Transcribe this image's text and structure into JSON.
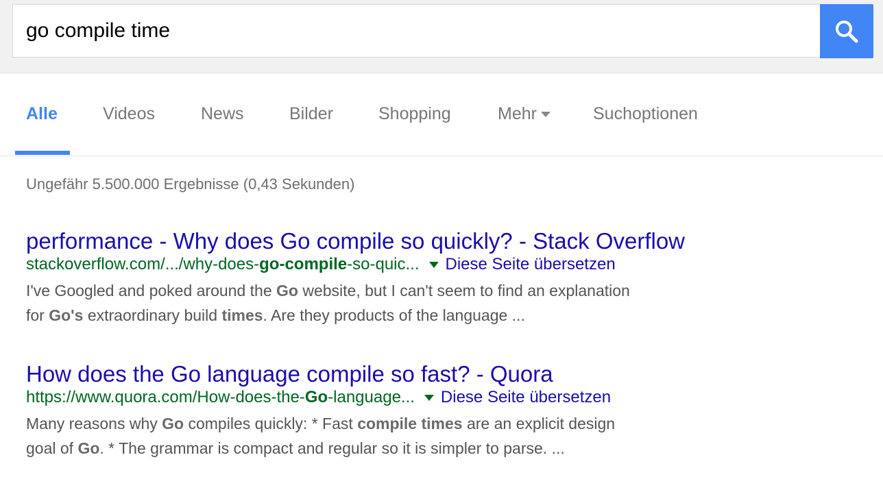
{
  "search": {
    "query": "go compile time",
    "button_icon": "search-icon",
    "button_color": "#4285f4"
  },
  "tabs": {
    "items": [
      {
        "label": "Alle",
        "active": true
      },
      {
        "label": "Videos",
        "active": false
      },
      {
        "label": "News",
        "active": false
      },
      {
        "label": "Bilder",
        "active": false
      },
      {
        "label": "Shopping",
        "active": false
      },
      {
        "label": "Mehr",
        "active": false,
        "dropdown": true
      },
      {
        "label": "Suchoptionen",
        "active": false
      }
    ]
  },
  "stats": {
    "text": "Ungefähr 5.500.000 Ergebnisse (0,43 Sekunden)"
  },
  "results": [
    {
      "title": "performance - Why does Go compile so quickly? - Stack Overflow",
      "url_parts": [
        {
          "text": "stackoverflow.com/.../why-does-",
          "bold": false
        },
        {
          "text": "go-compile",
          "bold": true
        },
        {
          "text": "-so-quic...",
          "bold": false
        }
      ],
      "translate": "Diese Seite übersetzen",
      "snippet_lines": [
        [
          {
            "text": "I've Googled and poked around the ",
            "bold": false
          },
          {
            "text": "Go",
            "bold": true
          },
          {
            "text": " website, but I can't seem to find an explanation",
            "bold": false
          }
        ],
        [
          {
            "text": "for ",
            "bold": false
          },
          {
            "text": "Go's",
            "bold": true
          },
          {
            "text": " extraordinary build ",
            "bold": false
          },
          {
            "text": "times",
            "bold": true
          },
          {
            "text": ". Are they products of the language  ...",
            "bold": false
          }
        ]
      ]
    },
    {
      "title": "How does the Go language compile so fast? - Quora",
      "url_parts": [
        {
          "text": "https://www.quora.com/How-does-the-",
          "bold": false
        },
        {
          "text": "Go",
          "bold": true
        },
        {
          "text": "-language...",
          "bold": false
        }
      ],
      "translate": "Diese Seite übersetzen",
      "snippet_lines": [
        [
          {
            "text": "Many reasons why ",
            "bold": false
          },
          {
            "text": "Go",
            "bold": true
          },
          {
            "text": " compiles quickly: * Fast ",
            "bold": false
          },
          {
            "text": "compile times",
            "bold": true
          },
          {
            "text": " are an explicit design",
            "bold": false
          }
        ],
        [
          {
            "text": "goal of ",
            "bold": false
          },
          {
            "text": "Go",
            "bold": true
          },
          {
            "text": ". * The grammar is compact and regular so it is simpler to parse. ...",
            "bold": false
          }
        ]
      ]
    }
  ],
  "colors": {
    "accent": "#4285f4",
    "link": "#1a0dab",
    "url": "#006621",
    "snippet": "#545454"
  }
}
